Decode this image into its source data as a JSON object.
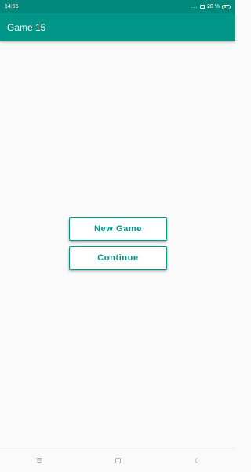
{
  "status_bar": {
    "time": "14:55",
    "signal_dots": "...",
    "battery_percent": "28 %",
    "icons": [
      "sim-icon",
      "battery-icon"
    ]
  },
  "app_bar": {
    "title": "Game 15",
    "color": "#009688"
  },
  "main": {
    "new_game_label": "New Game",
    "continue_label": "Continue"
  },
  "nav_bar": {
    "icons": [
      "menu-icon",
      "home-icon",
      "back-icon"
    ]
  }
}
